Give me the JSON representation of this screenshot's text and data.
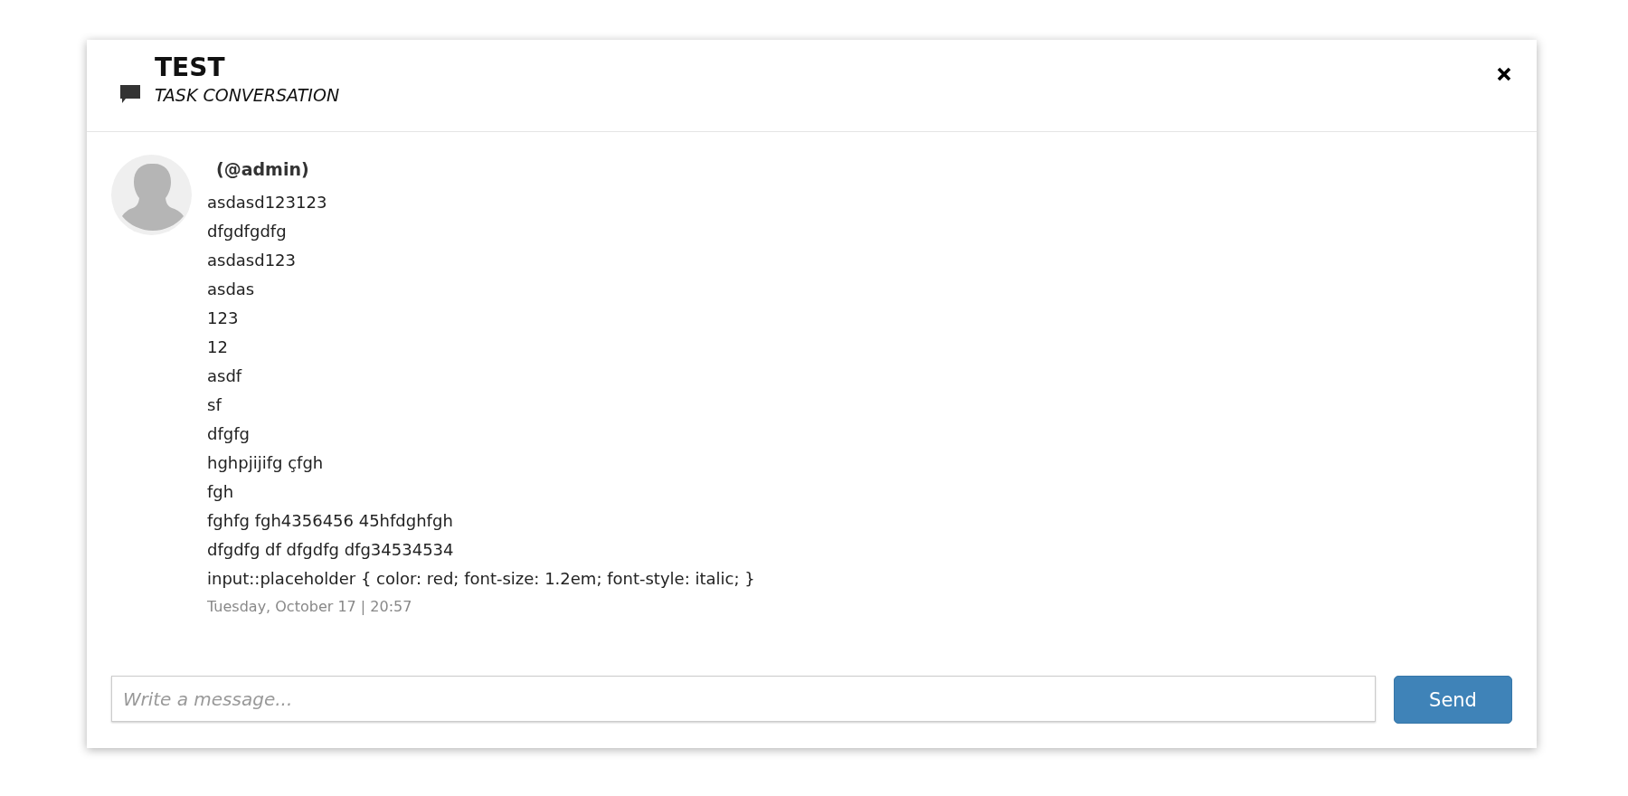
{
  "dialog": {
    "title": "TEST",
    "subtitle": "TASK CONVERSATION"
  },
  "messages": [
    {
      "author": "(@admin)",
      "lines": [
        "asdasd123123",
        "dfgdfgdfg",
        "asdasd123",
        "asdas",
        "123",
        "12",
        "asdf",
        "sf",
        "dfgfg",
        "hghpjijifg çfgh",
        "fgh",
        "fghfg fgh4356456 45hfdghfgh",
        "dfgdfg df dfgdfg dfg34534534",
        "input::placeholder { color: red; font-size: 1.2em; font-style: italic; }"
      ],
      "timestamp": "Tuesday, October 17 | 20:57"
    }
  ],
  "composer": {
    "placeholder": "Write a message...",
    "send_label": "Send"
  }
}
